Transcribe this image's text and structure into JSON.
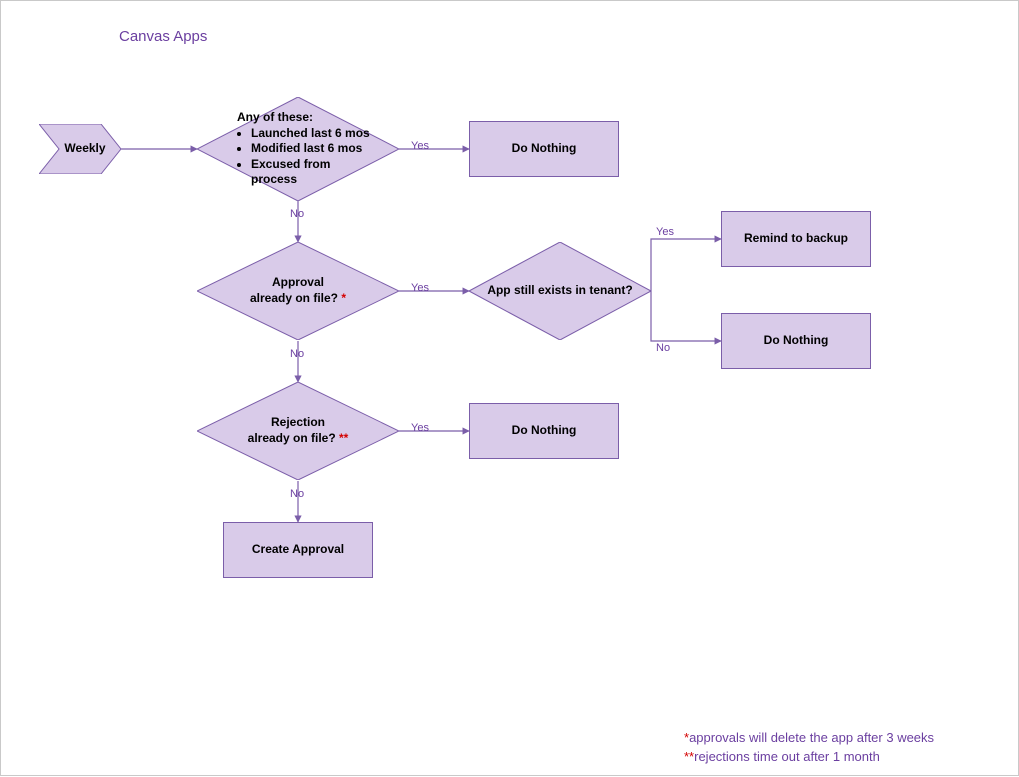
{
  "title": "Canvas Apps",
  "start": {
    "label": "Weekly"
  },
  "d1": {
    "header": "Any of these:",
    "bullets": [
      "Launched last 6 mos",
      "Modified last 6 mos",
      "Excused from process"
    ],
    "yes": "Yes",
    "no": "No"
  },
  "d2": {
    "line1": "Approval",
    "line2": "already on file? ",
    "star": "*",
    "yes": "Yes",
    "no": "No"
  },
  "d3": {
    "label": "App still exists in tenant?",
    "yes": "Yes",
    "no": "No"
  },
  "d4": {
    "line1": "Rejection",
    "line2": "already on file? ",
    "star": "**",
    "yes": "Yes",
    "no": "No"
  },
  "rects": {
    "doNothing1": "Do Nothing",
    "remind": "Remind to backup",
    "doNothing2": "Do Nothing",
    "doNothing3": "Do Nothing",
    "createApproval": "Create Approval"
  },
  "footnotes": {
    "f1_star": "*",
    "f1_text": "approvals will delete the app after 3 weeks",
    "f2_star": "**",
    "f2_text": "rejections time out after 1 month"
  },
  "colors": {
    "fill": "#d9cbe9",
    "stroke": "#7b5ea9",
    "accent": "#6b3fa0",
    "red": "#d40000"
  },
  "chart_data": {
    "type": "flowchart",
    "title": "Canvas Apps",
    "nodes": [
      {
        "id": "start",
        "kind": "start",
        "label": "Weekly"
      },
      {
        "id": "d1",
        "kind": "decision",
        "label": "Any of these: Launched last 6 mos; Modified last 6 mos; Excused from process"
      },
      {
        "id": "r1",
        "kind": "process",
        "label": "Do Nothing"
      },
      {
        "id": "d2",
        "kind": "decision",
        "label": "Approval already on file? *"
      },
      {
        "id": "d3",
        "kind": "decision",
        "label": "App still exists in tenant?"
      },
      {
        "id": "r2",
        "kind": "process",
        "label": "Remind to backup"
      },
      {
        "id": "r3",
        "kind": "process",
        "label": "Do Nothing"
      },
      {
        "id": "d4",
        "kind": "decision",
        "label": "Rejection already on file? **"
      },
      {
        "id": "r4",
        "kind": "process",
        "label": "Do Nothing"
      },
      {
        "id": "r5",
        "kind": "process",
        "label": "Create Approval"
      }
    ],
    "edges": [
      {
        "from": "start",
        "to": "d1",
        "label": ""
      },
      {
        "from": "d1",
        "to": "r1",
        "label": "Yes"
      },
      {
        "from": "d1",
        "to": "d2",
        "label": "No"
      },
      {
        "from": "d2",
        "to": "d3",
        "label": "Yes"
      },
      {
        "from": "d2",
        "to": "d4",
        "label": "No"
      },
      {
        "from": "d3",
        "to": "r2",
        "label": "Yes"
      },
      {
        "from": "d3",
        "to": "r3",
        "label": "No"
      },
      {
        "from": "d4",
        "to": "r4",
        "label": "Yes"
      },
      {
        "from": "d4",
        "to": "r5",
        "label": "No"
      }
    ],
    "footnotes": [
      "*approvals will delete the app after 3 weeks",
      "**rejections time out after 1 month"
    ]
  }
}
